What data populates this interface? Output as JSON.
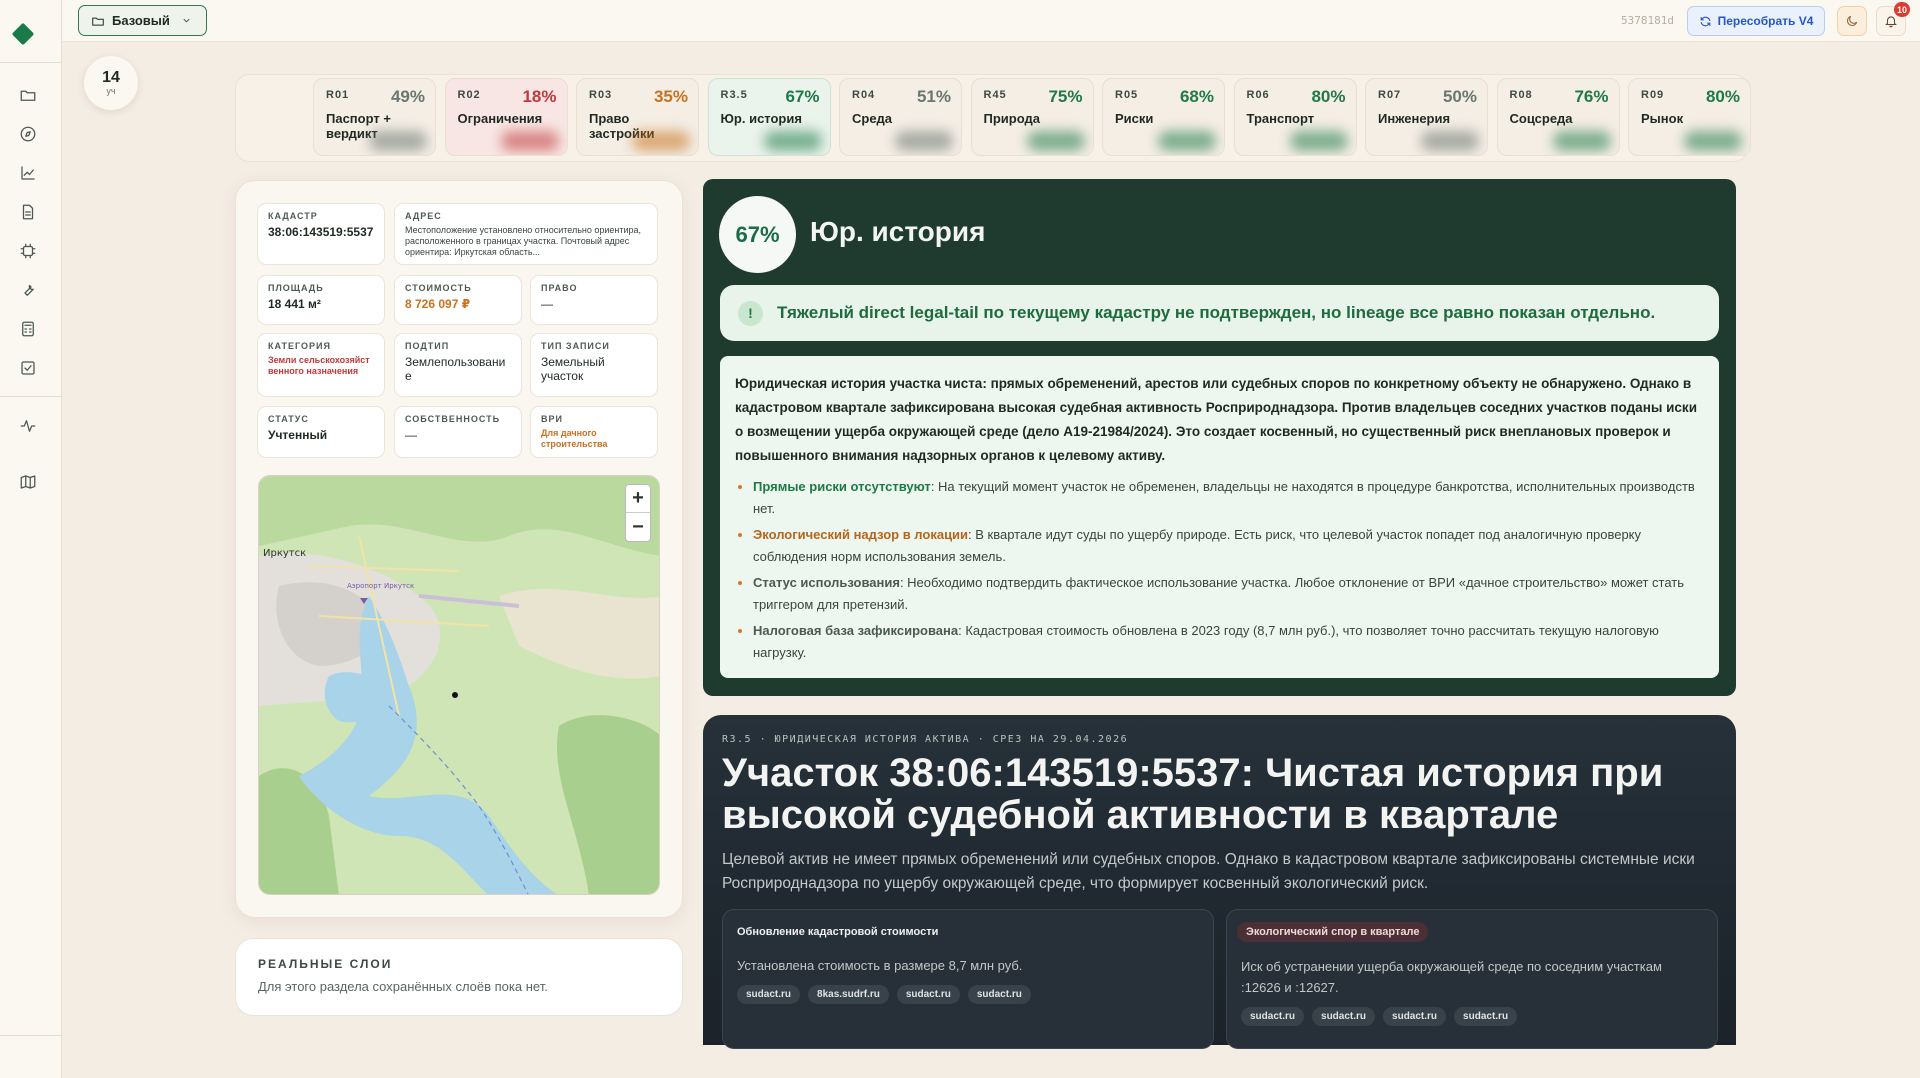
{
  "header": {
    "profile_label": "Базовый",
    "build_hash": "5378181d",
    "rebuild_label": "Пересобрать V4",
    "notifications_count": "10"
  },
  "count_chip": {
    "value": "14",
    "unit": "уч"
  },
  "reports": [
    {
      "code": "R01",
      "pct": "49%",
      "label": "Паспорт + вердикт",
      "color": "#6b7670"
    },
    {
      "code": "R02",
      "pct": "18%",
      "label": "Ограничения",
      "color": "#c2393b"
    },
    {
      "code": "R03",
      "pct": "35%",
      "label": "Право застройки",
      "color": "#c8711f"
    },
    {
      "code": "R3.5",
      "pct": "67%",
      "label": "Юр. история",
      "color": "#1f7a48"
    },
    {
      "code": "R04",
      "pct": "51%",
      "label": "Среда",
      "color": "#6b7670"
    },
    {
      "code": "R45",
      "pct": "75%",
      "label": "Природа",
      "color": "#1f7a48"
    },
    {
      "code": "R05",
      "pct": "68%",
      "label": "Риски",
      "color": "#1f7a48"
    },
    {
      "code": "R06",
      "pct": "80%",
      "label": "Транспорт",
      "color": "#1f7a48"
    },
    {
      "code": "R07",
      "pct": "50%",
      "label": "Инженерия",
      "color": "#6b7670"
    },
    {
      "code": "R08",
      "pct": "76%",
      "label": "Соцсреда",
      "color": "#1f7a48"
    },
    {
      "code": "R09",
      "pct": "80%",
      "label": "Рынок",
      "color": "#1f7a48"
    }
  ],
  "passport": {
    "cadastre": {
      "k": "КАДАСТР",
      "v": "38:06:143519:5537"
    },
    "address": {
      "k": "АДРЕС",
      "v": "Местоположение установлено относительно ориентира, расположенного в границах участка. Почтовый адрес ориентира: Иркутская область..."
    },
    "area": {
      "k": "ПЛОЩАДЬ",
      "v": "18 441 м²"
    },
    "cost": {
      "k": "СТОИМОСТЬ",
      "v": "8 726 097 ₽"
    },
    "right": {
      "k": "ПРАВО",
      "v": "—"
    },
    "category": {
      "k": "КАТЕГОРИЯ",
      "v": "Земли сельскохозяйственного назначения"
    },
    "subtype": {
      "k": "ПОДТИП",
      "v": "Землепользование"
    },
    "record_type": {
      "k": "ТИП ЗАПИСИ",
      "v": "Земельный участок"
    },
    "status": {
      "k": "СТАТУС",
      "v": "Учтенный"
    },
    "ownership": {
      "k": "СОБСТВЕННОСТЬ",
      "v": "—"
    },
    "vri": {
      "k": "ВРИ",
      "v": "Для дачного строительства"
    },
    "map": {
      "city_label": "Иркутск",
      "airport_label": "Аэропорт Иркутск",
      "zoom_in": "+",
      "zoom_out": "−"
    }
  },
  "layers": {
    "title": "РЕАЛЬНЫЕ СЛОИ",
    "desc": "Для этого раздела сохранённых слоёв пока нет."
  },
  "legal": {
    "score": "67%",
    "title": "Юр. история",
    "alert_icon": "!",
    "alert": "Тяжелый direct legal-tail по текущему кадастру не подтвержден, но lineage все равно показан отдельно.",
    "summary": "Юридическая история участка чиста: прямых обременений, арестов или судебных споров по конкретному объекту не обнаружено. Однако в кадастровом квартале зафиксирована высокая судебная активность Росприроднадзора. Против владельцев соседних участков поданы иски о возмещении ущерба окружающей среде (дело А19-21984/2024). Это создает косвенный, но существенный риск внеплановых проверок и повышенного внимания надзорных органов к целевому активу.",
    "bullets": [
      {
        "head": "Прямые риски отсутствуют",
        "text": ": На текущий момент участок не обременен, владельцы не находятся в процедуре банкротства, исполнительных производств нет.",
        "color": "#1e7a45"
      },
      {
        "head": "Экологический надзор в локации",
        "text": ": В квартале идут суды по ущербу природе. Есть риск, что целевой участок попадет под аналогичную проверку соблюдения норм использования земель.",
        "color": "#b8651a"
      },
      {
        "head": "Статус использования",
        "text": ": Необходимо подтвердить фактическое использование участка. Любое отклонение от ВРИ «дачное строительство» может стать триггером для претензий.",
        "color": "#4b5a52"
      },
      {
        "head": "Налоговая база зафиксирована",
        "text": ": Кадастровая стоимость обновлена в 2023 году (8,7 млн руб.), что позволяет точно рассчитать текущую налоговую нагрузку.",
        "color": "#4b5a52"
      }
    ]
  },
  "history": {
    "eyebrow": "R3.5 · ЮРИДИЧЕСКАЯ ИСТОРИЯ АКТИВА · СРЕЗ НА 29.04.2026",
    "title": "Участок 38:06:143519:5537: Чистая история при высокой судебной активности в квартале",
    "lead": "Целевой актив не имеет прямых обременений или судебных споров. Однако в кадастровом квартале зафиксированы системные иски Росприроднадзора по ущербу окружающей среде, что формирует косвенный экологический риск.",
    "events": [
      {
        "head": "Обновление кадастровой стоимости",
        "body": "Установлена стоимость в размере 8,7 млн руб.",
        "tags": [
          "sudact.ru",
          "8kas.sudrf.ru",
          "sudact.ru",
          "sudact.ru"
        ]
      },
      {
        "head": "Экологический спор в квартале",
        "body": "Иск об устранении ущерба окружающей среде по соседним участкам :12626 и :12627.",
        "tags": [
          "sudact.ru",
          "sudact.ru",
          "sudact.ru",
          "sudact.ru"
        ]
      }
    ]
  }
}
